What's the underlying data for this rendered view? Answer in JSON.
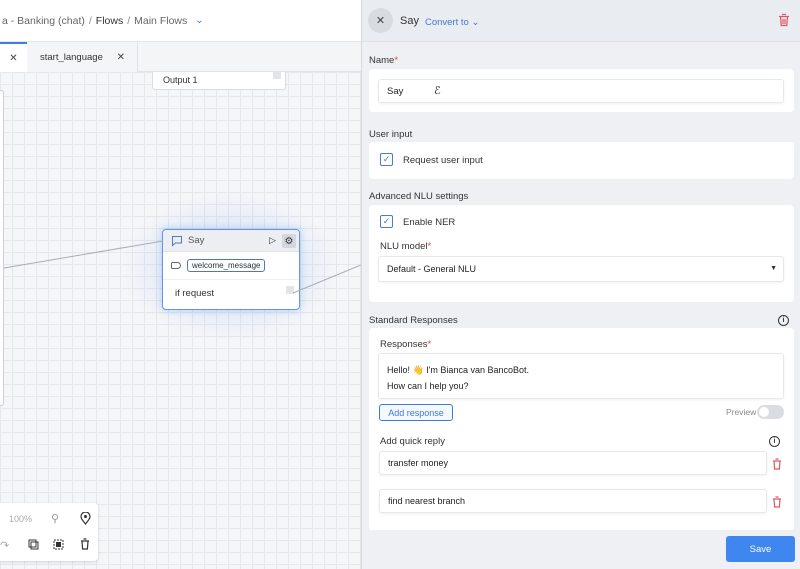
{
  "breadcrumb": {
    "project": "a - Banking (chat)",
    "flows": "Flows",
    "current": "Main Flows"
  },
  "tabs": [
    {
      "label": ""
    },
    {
      "label": "start_language"
    }
  ],
  "canvas": {
    "output_node_label": "Output 1",
    "say_node": {
      "title": "Say",
      "chip": "welcome_message",
      "branch": "if request"
    },
    "zoom_level": "100%"
  },
  "panel": {
    "title": "Say",
    "convert_label": "Convert to",
    "name_label": "Name",
    "name_value": "Say",
    "user_input_section": "User input",
    "request_user_input_label": "Request user input",
    "advanced_nlu_section": "Advanced NLU settings",
    "enable_ner_label": "Enable NER",
    "nlu_model_label": "NLU model",
    "nlu_model_value": "Default - General NLU",
    "standard_responses_section": "Standard Responses",
    "responses_label": "Responses",
    "response_line1": "Hello! 👋 I'm Bianca van BancoBot.",
    "response_line2": "How can I help you?",
    "add_response_label": "Add response",
    "preview_label": "Preview",
    "add_quick_reply_label": "Add quick reply",
    "quick_replies": [
      "transfer money",
      "find nearest branch"
    ],
    "save_label": "Save"
  },
  "colors": {
    "accent": "#3f7bd6",
    "danger": "#e05561",
    "save_button": "#3f86ef"
  }
}
